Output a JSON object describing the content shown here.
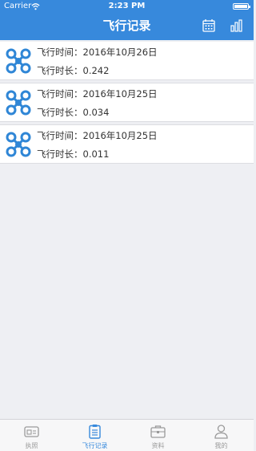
{
  "status_bar": {
    "carrier": "Carrier",
    "time": "2:23 PM"
  },
  "nav": {
    "title": "飞行记录",
    "calendar_icon": "calendar-icon",
    "stats_icon": "bar-chart-icon"
  },
  "records": [
    {
      "time_label": "飞行时间：",
      "time_value": "2016年10月26日",
      "duration_label": "飞行时长：",
      "duration_value": "0.242"
    },
    {
      "time_label": "飞行时间：",
      "time_value": "2016年10月25日",
      "duration_label": "飞行时长：",
      "duration_value": "0.034"
    },
    {
      "time_label": "飞行时间：",
      "time_value": "2016年10月25日",
      "duration_label": "飞行时长：",
      "duration_value": "0.011"
    }
  ],
  "tabs": [
    {
      "label": "执照",
      "icon": "license-icon",
      "active": false
    },
    {
      "label": "飞行记录",
      "icon": "clipboard-icon",
      "active": true
    },
    {
      "label": "资料",
      "icon": "briefcase-icon",
      "active": false
    },
    {
      "label": "我的",
      "icon": "user-icon",
      "active": false
    }
  ],
  "colors": {
    "accent": "#3789dc",
    "tab_inactive": "#9a9a9a",
    "background": "#eeeff3"
  }
}
